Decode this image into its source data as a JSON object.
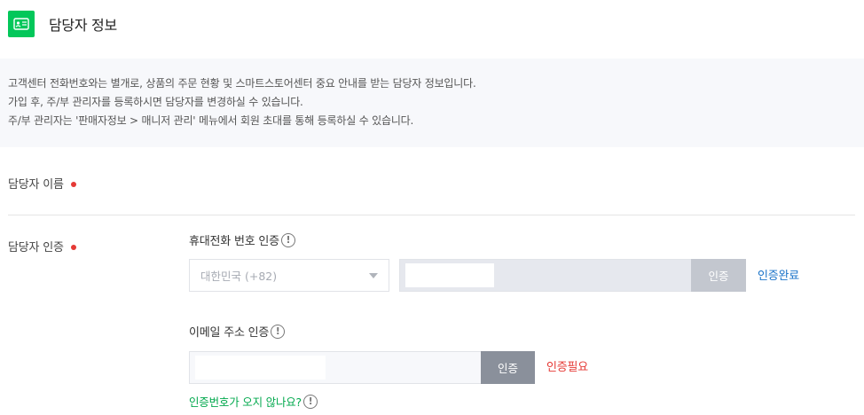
{
  "header": {
    "title": "담당자 정보",
    "icon": "id-card-icon",
    "icon_bg": "#03c75a"
  },
  "notice": {
    "lines": [
      "고객센터 전화번호와는 별개로, 상품의 주문 현황 및 스마트스토어센터 중요 안내를 받는 담당자 정보입니다.",
      "가입 후, 주/부 관리자를 등록하시면 담당자를 변경하실 수 있습니다.",
      "주/부 관리자는 '판매자정보 > 매니저 관리' 메뉴에서 회원 초대를 통해 등록하실 수 있습니다."
    ]
  },
  "manager_name": {
    "label": "담당자 이름",
    "required_color": "#e53935"
  },
  "manager_auth": {
    "label": "담당자 인증",
    "phone": {
      "title": "휴대전화 번호 인증",
      "info_icon": "exclamation-circle-icon",
      "country_value": "대한민국 (+82)",
      "verify_label": "인증",
      "status": "인증완료",
      "status_color": "#1a73c9"
    },
    "email": {
      "title": "이메일 주소 인증",
      "info_icon": "exclamation-circle-icon",
      "verify_label": "인증",
      "status": "인증필요",
      "status_color": "#e53935"
    },
    "help_link": "인증번호가 오지 않나요?"
  }
}
